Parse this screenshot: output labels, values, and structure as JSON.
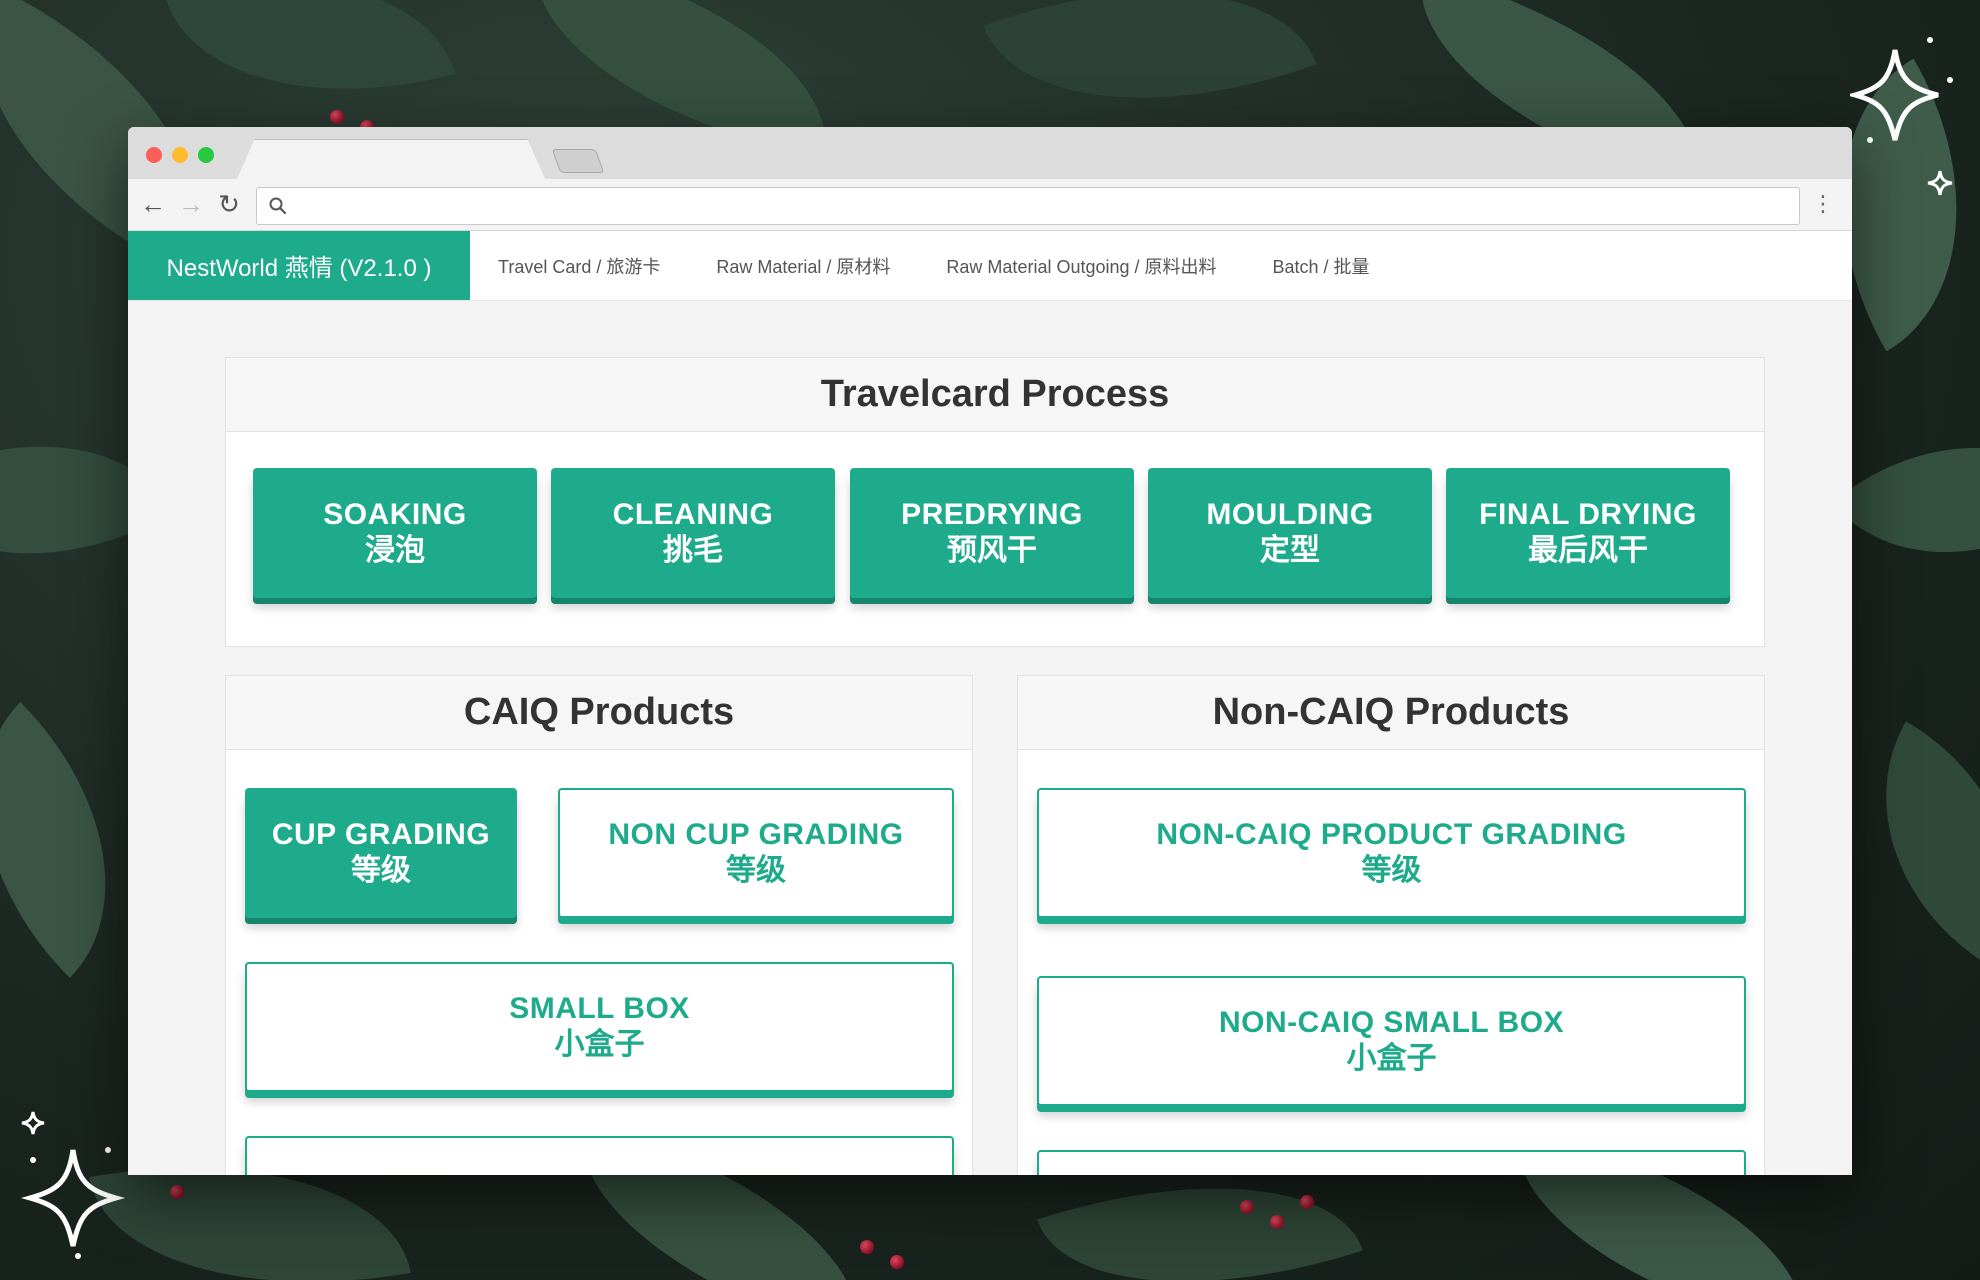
{
  "app": {
    "brand": "NestWorld 燕情 (V2.1.0 )",
    "nav": [
      {
        "label": "Travel Card / 旅游卡"
      },
      {
        "label": "Raw Material / 原材料"
      },
      {
        "label": "Raw Material Outgoing / 原料出料"
      },
      {
        "label": "Batch / 批量"
      }
    ]
  },
  "browser": {
    "address": ""
  },
  "travelcard": {
    "title": "Travelcard Process",
    "steps": [
      {
        "en": "SOAKING",
        "zh": "浸泡"
      },
      {
        "en": "CLEANING",
        "zh": "挑毛"
      },
      {
        "en": "PREDRYING",
        "zh": "预风干"
      },
      {
        "en": "MOULDING",
        "zh": "定型"
      },
      {
        "en": "FINAL DRYING",
        "zh": "最后风干"
      }
    ]
  },
  "caiq": {
    "title": "CAIQ Products",
    "cup_grading": {
      "en": "CUP GRADING",
      "zh": "等级"
    },
    "non_cup_grading": {
      "en": "NON CUP GRADING",
      "zh": "等级"
    },
    "small_box": {
      "en": "SMALL BOX",
      "zh": "小盒子"
    }
  },
  "noncaiq": {
    "title": "Non-CAIQ Products",
    "grading": {
      "en": "NON-CAIQ PRODUCT GRADING",
      "zh": "等级"
    },
    "small_box": {
      "en": "NON-CAIQ SMALL BOX",
      "zh": "小盒子"
    }
  },
  "colors": {
    "accent": "#1eab8b",
    "accent_dark": "#17856c"
  },
  "icons": [
    "back-arrow-icon",
    "forward-arrow-icon",
    "reload-icon",
    "search-icon",
    "menu-dots-icon",
    "sparkle-icon"
  ]
}
